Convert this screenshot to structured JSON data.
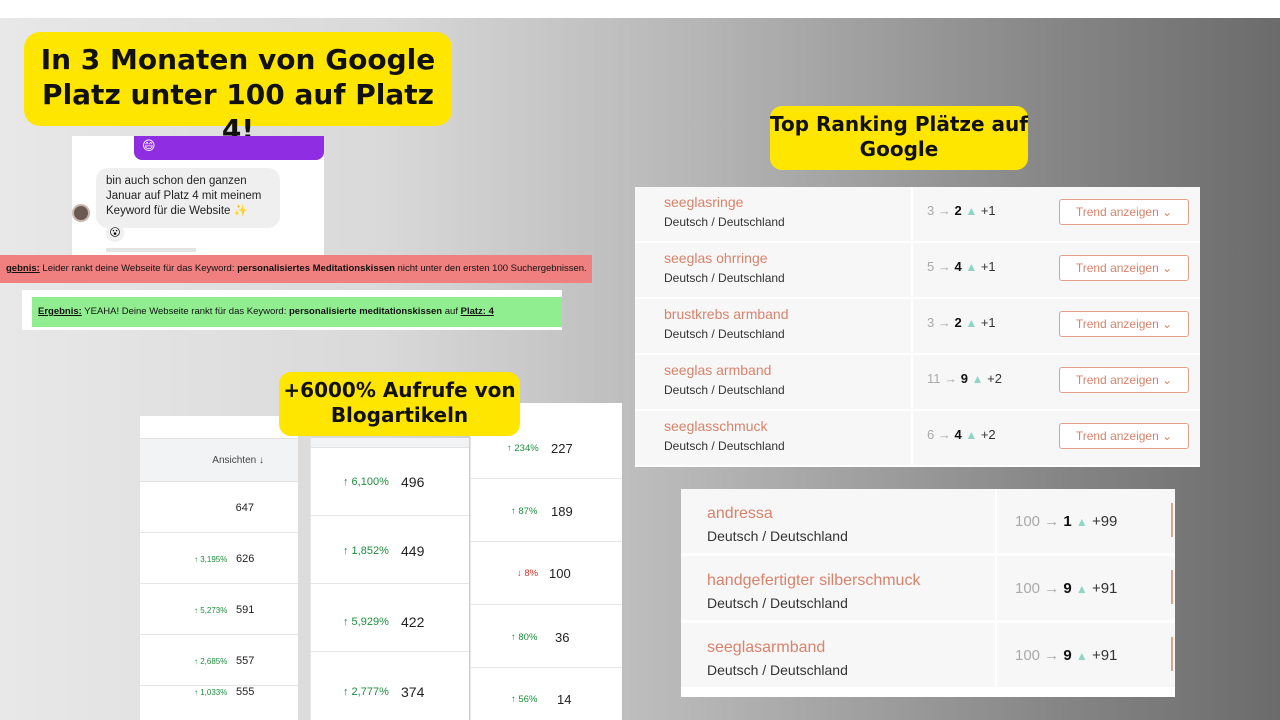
{
  "headline": {
    "line1": "In 3 Monaten von Google",
    "line2": "Platz unter 100 auf Platz 4!"
  },
  "callouts": {
    "ranking": {
      "line1": "Top Ranking Plätze auf",
      "line2": "Google"
    },
    "blog": {
      "line1": "+6000% Aufrufe von",
      "line2": "Blogartikeln"
    }
  },
  "chat": {
    "emoji_top": "😄",
    "message": "bin auch schon den ganzen Januar auf Platz 4 mit meinem Keyword für die Website ✨",
    "reaction": "😮"
  },
  "results": {
    "red": {
      "label": "gebnis:",
      "text": " Leider rankt deine Webseite für das Keyword: ",
      "keyword": "personalisiertes Meditationskissen",
      "tail": " nicht unter den ersten 100 Suchergebnissen."
    },
    "green": {
      "label": "Ergebnis:",
      "text": " YEAHA! Deine Webseite rankt für das Keyword: ",
      "keyword": "personalisierte meditationskissen",
      "mid": " auf ",
      "place": "Platz: 4"
    }
  },
  "views_panel": {
    "header": "Ansichten ↓",
    "rows": [
      {
        "pct": "",
        "value": "647"
      },
      {
        "pct": "↑ 3,195%",
        "value": "626"
      },
      {
        "pct": "↑ 5,273%",
        "value": "591"
      },
      {
        "pct": "↑ 2,685%",
        "value": "557"
      },
      {
        "pct": "↑ 1,033%",
        "value": "555"
      }
    ]
  },
  "blog_panel": {
    "rows": [
      {
        "pct": "↑ 6,100%",
        "value": "496"
      },
      {
        "pct": "↑ 1,852%",
        "value": "449"
      },
      {
        "pct": "↑ 5,929%",
        "value": "422"
      },
      {
        "pct": "↑ 2,777%",
        "value": "374"
      }
    ]
  },
  "right_panel": {
    "rows": [
      {
        "pct": "↑ 234%",
        "value": "227",
        "dir": "up"
      },
      {
        "pct": "↑ 87%",
        "value": "189",
        "dir": "up"
      },
      {
        "pct": "↓ 8%",
        "value": "100",
        "dir": "down"
      },
      {
        "pct": "↑ 80%",
        "value": "36",
        "dir": "up"
      },
      {
        "pct": "↑ 56%",
        "value": "14",
        "dir": "up"
      }
    ]
  },
  "ranking_table_1": {
    "trend_label": "Trend anzeigen ⌄",
    "rows": [
      {
        "keyword": "seeglasringe",
        "location": "Deutsch / Deutschland",
        "from": "3",
        "to": "2",
        "delta": "+1"
      },
      {
        "keyword": "seeglas ohrringe",
        "location": "Deutsch / Deutschland",
        "from": "5",
        "to": "4",
        "delta": "+1"
      },
      {
        "keyword": "brustkrebs armband",
        "location": "Deutsch / Deutschland",
        "from": "3",
        "to": "2",
        "delta": "+1"
      },
      {
        "keyword": "seeglas armband",
        "location": "Deutsch / Deutschland",
        "from": "11",
        "to": "9",
        "delta": "+2"
      },
      {
        "keyword": "seeglasschmuck",
        "location": "Deutsch / Deutschland",
        "from": "6",
        "to": "4",
        "delta": "+2"
      }
    ]
  },
  "ranking_table_2": {
    "rows": [
      {
        "keyword": "andressa",
        "location": "Deutsch / Deutschland",
        "from": "100",
        "to": "1",
        "delta": "+99"
      },
      {
        "keyword": "handgefertigter silberschmuck",
        "location": "Deutsch / Deutschland",
        "from": "100",
        "to": "9",
        "delta": "+91"
      },
      {
        "keyword": "seeglasarmband",
        "location": "Deutsch / Deutschland",
        "from": "100",
        "to": "9",
        "delta": "+91"
      }
    ]
  },
  "colors": {
    "callout": "#ffe600",
    "keyword": "#d9826b",
    "up": "#1e8e3e",
    "down": "#d93025",
    "triangle": "#8fd6c6"
  }
}
